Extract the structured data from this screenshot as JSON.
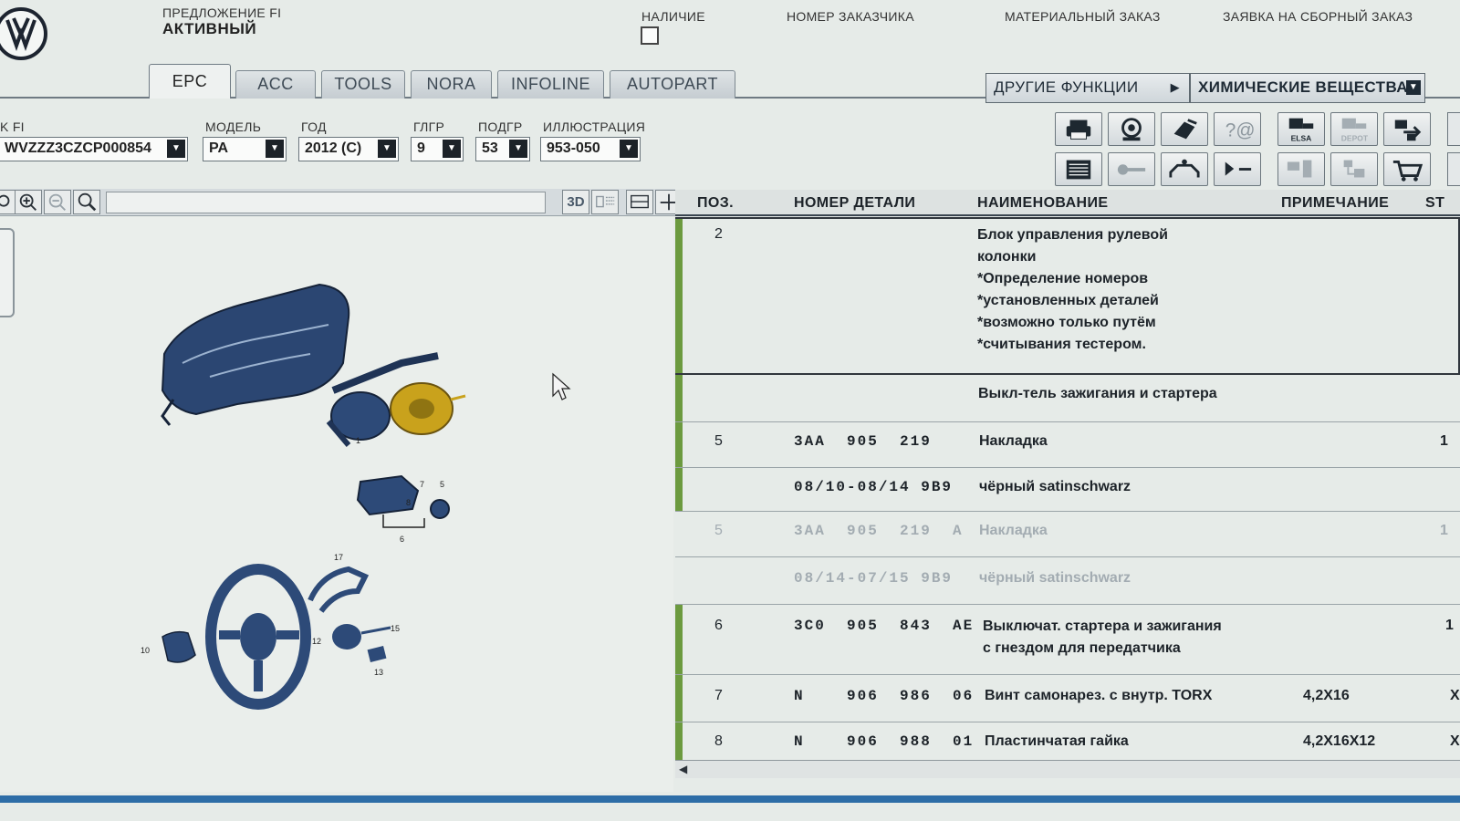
{
  "header": {
    "proposal_label": "ПРЕДЛОЖЕНИЕ FI",
    "proposal_value": "АКТИВНЫЙ",
    "availability_label": "НАЛИЧИЕ",
    "customer_number_label": "НОМЕР ЗАКАЗЧИКА",
    "material_order_label": "МАТЕРИАЛЬНЫЙ ЗАКАЗ",
    "assembly_order_label": "ЗАЯВКА НА СБОРНЫЙ ЗАКАЗ"
  },
  "tabs": [
    "EPC",
    "ACC",
    "TOOLS",
    "NORA",
    "INFOLINE",
    "AUTOPART"
  ],
  "functions": {
    "other_functions": "ДРУГИЕ ФУНКЦИИ",
    "chemicals": "ХИМИЧЕСКИЕ ВЕЩЕСТВА"
  },
  "filters": {
    "fi": {
      "label": "K FI",
      "value": "WVZZZ3CZCP000854"
    },
    "model": {
      "label": "МОДЕЛЬ",
      "value": "PA"
    },
    "year": {
      "label": "ГОД",
      "value": "2012 (C)"
    },
    "main_group": {
      "label": "ГЛГР",
      "value": "9"
    },
    "sub_group": {
      "label": "ПОДГР",
      "value": "53"
    },
    "illustration": {
      "label": "ИЛЛЮСТРАЦИЯ",
      "value": "953-050"
    }
  },
  "view_buttons": {
    "three_d": "3D"
  },
  "toolbar_icons": {
    "row1": [
      "printer-icon",
      "search-part-icon",
      "transfer-icon",
      "help-icon",
      "elsa-icon",
      "depot-icon",
      "export-icon"
    ],
    "row2": [
      "list-icon",
      "key-icon",
      "vehicle-icon",
      "play-icon",
      "compare-icon",
      "tree-icon",
      "cart-icon"
    ],
    "elsa_label": "ELSA",
    "depot_label": "DEPOT"
  },
  "table": {
    "columns": {
      "pos": "ПОЗ.",
      "part_number": "НОМЕР ДЕТАЛИ",
      "name": "НАИМЕНОВАНИЕ",
      "note": "ПРИМЕЧАНИЕ",
      "qty": "ST"
    },
    "rows": [
      {
        "pos": "2",
        "part": "",
        "name": "Блок управления рулевой\nколонки\n*Определение номеров\n*установленных деталей\n*возможно только путём\n*считывания тестером.",
        "note": "",
        "qty": ""
      },
      {
        "pos": "",
        "part": "",
        "name": "Выкл-тель зажигания и стартера",
        "note": "",
        "qty": ""
      },
      {
        "pos": "5",
        "part": "3AA  905  219",
        "name": "Накладка",
        "note": "",
        "qty": "1"
      },
      {
        "pos": "",
        "part": "08/10-08/14 9B9",
        "name": "чёрный satinschwarz",
        "note": "",
        "qty": ""
      },
      {
        "pos": "5",
        "part": "3AA  905  219  A",
        "name": "Накладка",
        "note": "",
        "qty": "1"
      },
      {
        "pos": "",
        "part": "08/14-07/15 9B9",
        "name": "чёрный satinschwarz",
        "note": "",
        "qty": ""
      },
      {
        "pos": "6",
        "part": "3C0  905  843  AE",
        "name": "Выключат. стартера и зажигания\nс гнездом для передатчика",
        "note": "",
        "qty": "1"
      },
      {
        "pos": "7",
        "part": "N    906  986  06",
        "name": "Винт самонарез. с внутр. TORX",
        "note": "4,2X16",
        "qty": "X"
      },
      {
        "pos": "8",
        "part": "N    906  988  01",
        "name": "Пластинчатая гайка",
        "note": "4,2X16X12",
        "qty": "X"
      }
    ]
  },
  "illustration_callouts": [
    "1",
    "5",
    "6",
    "7",
    "8",
    "10",
    "12",
    "13",
    "15",
    "17"
  ],
  "colors": {
    "accent_bar": "#6c9a3f",
    "bottom_strip": "#2d6da7",
    "part_highlight": "#c9a21c"
  }
}
